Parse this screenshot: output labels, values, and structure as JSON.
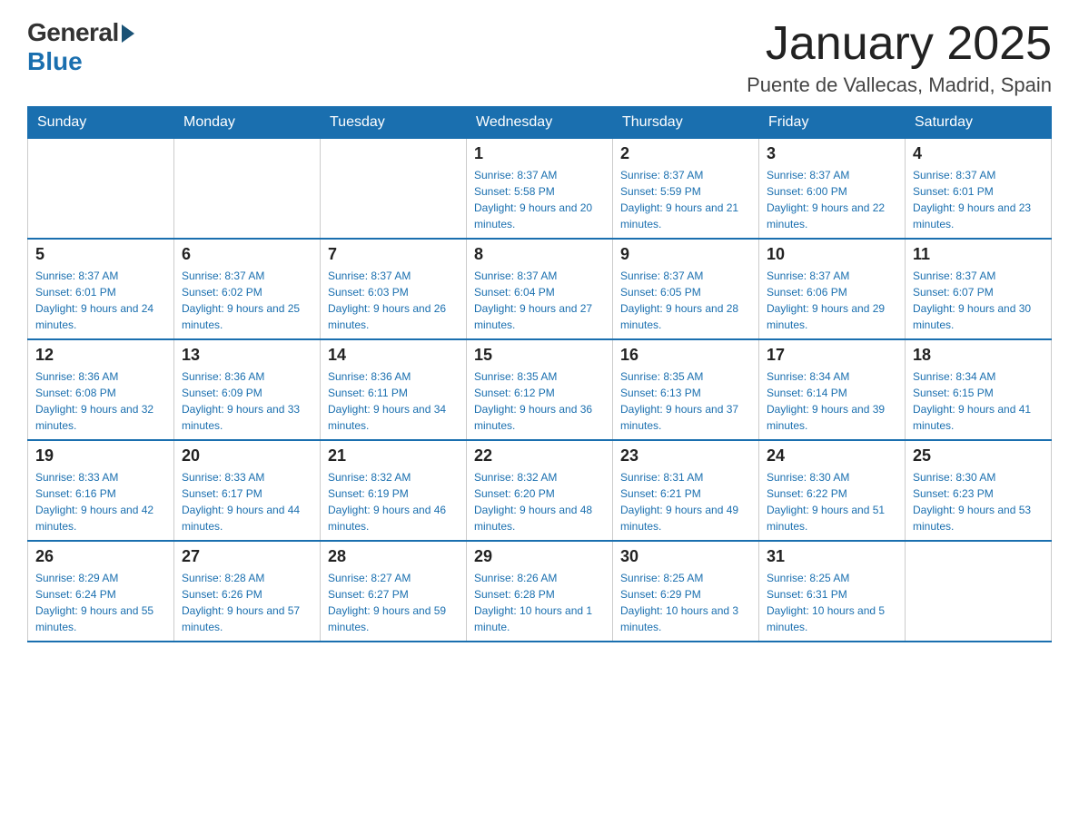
{
  "header": {
    "logo_general": "General",
    "logo_blue": "Blue",
    "title": "January 2025",
    "subtitle": "Puente de Vallecas, Madrid, Spain"
  },
  "days_of_week": [
    "Sunday",
    "Monday",
    "Tuesday",
    "Wednesday",
    "Thursday",
    "Friday",
    "Saturday"
  ],
  "weeks": [
    [
      null,
      null,
      null,
      {
        "day": "1",
        "sunrise": "Sunrise: 8:37 AM",
        "sunset": "Sunset: 5:58 PM",
        "daylight": "Daylight: 9 hours and 20 minutes."
      },
      {
        "day": "2",
        "sunrise": "Sunrise: 8:37 AM",
        "sunset": "Sunset: 5:59 PM",
        "daylight": "Daylight: 9 hours and 21 minutes."
      },
      {
        "day": "3",
        "sunrise": "Sunrise: 8:37 AM",
        "sunset": "Sunset: 6:00 PM",
        "daylight": "Daylight: 9 hours and 22 minutes."
      },
      {
        "day": "4",
        "sunrise": "Sunrise: 8:37 AM",
        "sunset": "Sunset: 6:01 PM",
        "daylight": "Daylight: 9 hours and 23 minutes."
      }
    ],
    [
      {
        "day": "5",
        "sunrise": "Sunrise: 8:37 AM",
        "sunset": "Sunset: 6:01 PM",
        "daylight": "Daylight: 9 hours and 24 minutes."
      },
      {
        "day": "6",
        "sunrise": "Sunrise: 8:37 AM",
        "sunset": "Sunset: 6:02 PM",
        "daylight": "Daylight: 9 hours and 25 minutes."
      },
      {
        "day": "7",
        "sunrise": "Sunrise: 8:37 AM",
        "sunset": "Sunset: 6:03 PM",
        "daylight": "Daylight: 9 hours and 26 minutes."
      },
      {
        "day": "8",
        "sunrise": "Sunrise: 8:37 AM",
        "sunset": "Sunset: 6:04 PM",
        "daylight": "Daylight: 9 hours and 27 minutes."
      },
      {
        "day": "9",
        "sunrise": "Sunrise: 8:37 AM",
        "sunset": "Sunset: 6:05 PM",
        "daylight": "Daylight: 9 hours and 28 minutes."
      },
      {
        "day": "10",
        "sunrise": "Sunrise: 8:37 AM",
        "sunset": "Sunset: 6:06 PM",
        "daylight": "Daylight: 9 hours and 29 minutes."
      },
      {
        "day": "11",
        "sunrise": "Sunrise: 8:37 AM",
        "sunset": "Sunset: 6:07 PM",
        "daylight": "Daylight: 9 hours and 30 minutes."
      }
    ],
    [
      {
        "day": "12",
        "sunrise": "Sunrise: 8:36 AM",
        "sunset": "Sunset: 6:08 PM",
        "daylight": "Daylight: 9 hours and 32 minutes."
      },
      {
        "day": "13",
        "sunrise": "Sunrise: 8:36 AM",
        "sunset": "Sunset: 6:09 PM",
        "daylight": "Daylight: 9 hours and 33 minutes."
      },
      {
        "day": "14",
        "sunrise": "Sunrise: 8:36 AM",
        "sunset": "Sunset: 6:11 PM",
        "daylight": "Daylight: 9 hours and 34 minutes."
      },
      {
        "day": "15",
        "sunrise": "Sunrise: 8:35 AM",
        "sunset": "Sunset: 6:12 PM",
        "daylight": "Daylight: 9 hours and 36 minutes."
      },
      {
        "day": "16",
        "sunrise": "Sunrise: 8:35 AM",
        "sunset": "Sunset: 6:13 PM",
        "daylight": "Daylight: 9 hours and 37 minutes."
      },
      {
        "day": "17",
        "sunrise": "Sunrise: 8:34 AM",
        "sunset": "Sunset: 6:14 PM",
        "daylight": "Daylight: 9 hours and 39 minutes."
      },
      {
        "day": "18",
        "sunrise": "Sunrise: 8:34 AM",
        "sunset": "Sunset: 6:15 PM",
        "daylight": "Daylight: 9 hours and 41 minutes."
      }
    ],
    [
      {
        "day": "19",
        "sunrise": "Sunrise: 8:33 AM",
        "sunset": "Sunset: 6:16 PM",
        "daylight": "Daylight: 9 hours and 42 minutes."
      },
      {
        "day": "20",
        "sunrise": "Sunrise: 8:33 AM",
        "sunset": "Sunset: 6:17 PM",
        "daylight": "Daylight: 9 hours and 44 minutes."
      },
      {
        "day": "21",
        "sunrise": "Sunrise: 8:32 AM",
        "sunset": "Sunset: 6:19 PM",
        "daylight": "Daylight: 9 hours and 46 minutes."
      },
      {
        "day": "22",
        "sunrise": "Sunrise: 8:32 AM",
        "sunset": "Sunset: 6:20 PM",
        "daylight": "Daylight: 9 hours and 48 minutes."
      },
      {
        "day": "23",
        "sunrise": "Sunrise: 8:31 AM",
        "sunset": "Sunset: 6:21 PM",
        "daylight": "Daylight: 9 hours and 49 minutes."
      },
      {
        "day": "24",
        "sunrise": "Sunrise: 8:30 AM",
        "sunset": "Sunset: 6:22 PM",
        "daylight": "Daylight: 9 hours and 51 minutes."
      },
      {
        "day": "25",
        "sunrise": "Sunrise: 8:30 AM",
        "sunset": "Sunset: 6:23 PM",
        "daylight": "Daylight: 9 hours and 53 minutes."
      }
    ],
    [
      {
        "day": "26",
        "sunrise": "Sunrise: 8:29 AM",
        "sunset": "Sunset: 6:24 PM",
        "daylight": "Daylight: 9 hours and 55 minutes."
      },
      {
        "day": "27",
        "sunrise": "Sunrise: 8:28 AM",
        "sunset": "Sunset: 6:26 PM",
        "daylight": "Daylight: 9 hours and 57 minutes."
      },
      {
        "day": "28",
        "sunrise": "Sunrise: 8:27 AM",
        "sunset": "Sunset: 6:27 PM",
        "daylight": "Daylight: 9 hours and 59 minutes."
      },
      {
        "day": "29",
        "sunrise": "Sunrise: 8:26 AM",
        "sunset": "Sunset: 6:28 PM",
        "daylight": "Daylight: 10 hours and 1 minute."
      },
      {
        "day": "30",
        "sunrise": "Sunrise: 8:25 AM",
        "sunset": "Sunset: 6:29 PM",
        "daylight": "Daylight: 10 hours and 3 minutes."
      },
      {
        "day": "31",
        "sunrise": "Sunrise: 8:25 AM",
        "sunset": "Sunset: 6:31 PM",
        "daylight": "Daylight: 10 hours and 5 minutes."
      },
      null
    ]
  ]
}
